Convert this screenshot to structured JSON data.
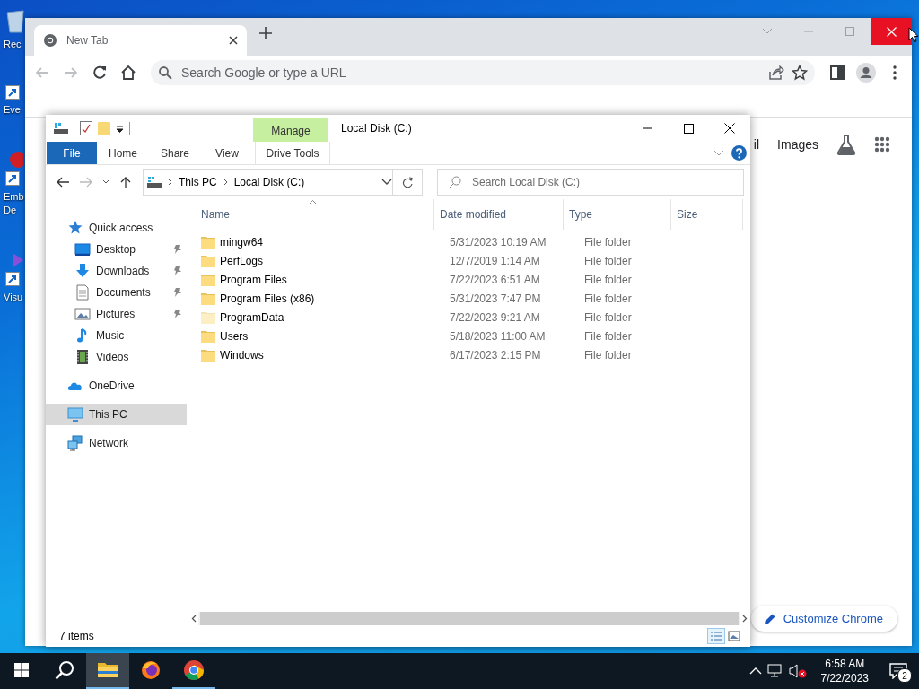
{
  "desktop_icons": [
    {
      "kind": "recycle",
      "label_lines": [
        "Rec"
      ]
    },
    {
      "kind": "shortcut",
      "label_lines": [
        "Eve"
      ]
    },
    {
      "kind": "shortcut-red",
      "label_lines": [
        "Emb",
        "De"
      ]
    },
    {
      "kind": "shortcut-purple",
      "label_lines": [
        "Visu"
      ]
    }
  ],
  "chrome": {
    "tabs": [
      {
        "title": "New Tab",
        "selected": true
      }
    ],
    "omnibox": {
      "placeholder": "Search Google or type a URL"
    },
    "links": [
      "il",
      "Images"
    ],
    "customize_button": "Customize Chrome"
  },
  "explorer": {
    "title": "Local Disk (C:)",
    "ribbon_tabs": [
      {
        "label": "File",
        "kind": "file"
      },
      {
        "label": "Home",
        "kind": "plain"
      },
      {
        "label": "Share",
        "kind": "plain"
      },
      {
        "label": "View",
        "kind": "plain"
      },
      {
        "label": "Drive Tools",
        "kind": "contextual",
        "group": "Manage"
      }
    ],
    "breadcrumb": [
      "This PC",
      "Local Disk (C:)"
    ],
    "search": {
      "placeholder": "Search Local Disk (C:)"
    },
    "nav": [
      {
        "label": "Quick access",
        "kind": "star",
        "selected": false,
        "children": [
          {
            "label": "Desktop",
            "kind": "desktop",
            "selected": false,
            "pinned": true
          },
          {
            "label": "Downloads",
            "kind": "download",
            "selected": false,
            "pinned": true
          },
          {
            "label": "Documents",
            "kind": "document",
            "selected": false,
            "pinned": true
          },
          {
            "label": "Pictures",
            "kind": "pictures",
            "selected": false,
            "pinned": true
          },
          {
            "label": "Music",
            "kind": "music",
            "selected": false,
            "pinned": false
          },
          {
            "label": "Videos",
            "kind": "videos",
            "selected": false,
            "pinned": false
          }
        ]
      },
      {
        "label": "OneDrive",
        "kind": "cloud",
        "selected": false
      },
      {
        "label": "This PC",
        "kind": "pc",
        "selected": true
      },
      {
        "label": "Network",
        "kind": "network",
        "selected": false
      }
    ],
    "columns": [
      {
        "label": "Name",
        "sorted": true
      },
      {
        "label": "Date modified",
        "sorted": false
      },
      {
        "label": "Type",
        "sorted": false
      },
      {
        "label": "Size",
        "sorted": false
      }
    ],
    "rows": [
      {
        "name": "mingw64",
        "date": "5/31/2023 10:19 AM",
        "type": "File folder",
        "hidden": false
      },
      {
        "name": "PerfLogs",
        "date": "12/7/2019 1:14 AM",
        "type": "File folder",
        "hidden": false
      },
      {
        "name": "Program Files",
        "date": "7/22/2023 6:51 AM",
        "type": "File folder",
        "hidden": false
      },
      {
        "name": "Program Files (x86)",
        "date": "5/31/2023 7:47 PM",
        "type": "File folder",
        "hidden": false
      },
      {
        "name": "ProgramData",
        "date": "7/22/2023 9:21 AM",
        "type": "File folder",
        "hidden": true
      },
      {
        "name": "Users",
        "date": "5/18/2023 11:00 AM",
        "type": "File folder",
        "hidden": false
      },
      {
        "name": "Windows",
        "date": "6/17/2023 2:15 PM",
        "type": "File folder",
        "hidden": false
      }
    ],
    "status": "7 items"
  },
  "taskbar": {
    "apps": [
      {
        "kind": "explorer",
        "active": true,
        "running": true
      },
      {
        "kind": "firefox",
        "active": false,
        "running": false
      },
      {
        "kind": "chrome",
        "active": false,
        "running": true
      }
    ],
    "clock": {
      "time": "6:58 AM",
      "date": "7/22/2023"
    },
    "notification_count": "2"
  }
}
